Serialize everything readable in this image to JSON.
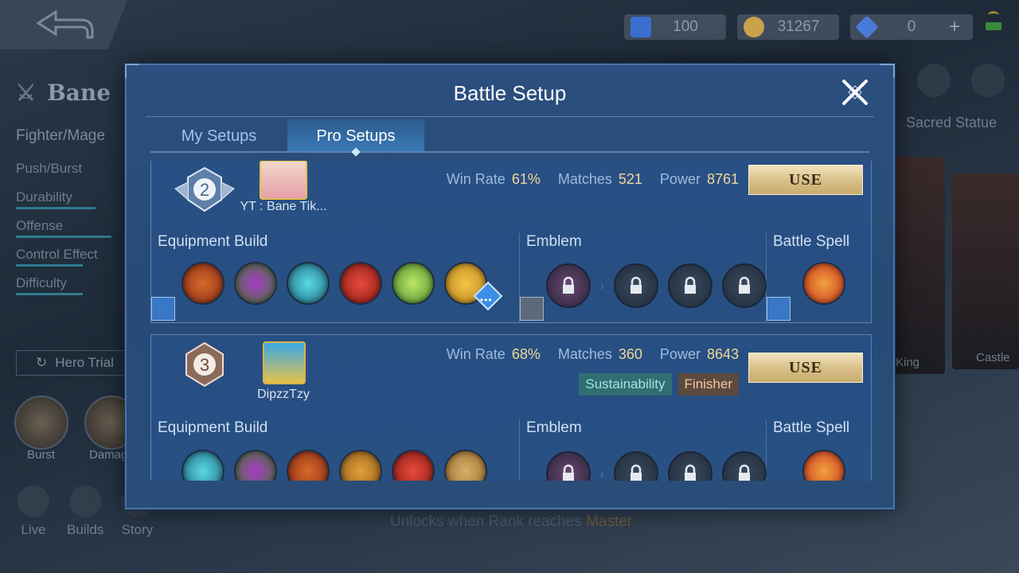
{
  "background": {
    "resources": [
      {
        "name": "ticket",
        "value": "100",
        "color": "#3a6fd0"
      },
      {
        "name": "battle-points",
        "value": "31267",
        "color": "#c9a24a"
      },
      {
        "name": "diamonds",
        "value": "0",
        "color": "#4a7ad8"
      }
    ],
    "plus_label": "+",
    "hero": {
      "name": "Bane",
      "role": "Fighter/Mage",
      "stats": [
        "Push/Burst",
        "Durability",
        "Offense",
        "Control Effect",
        "Difficulty"
      ],
      "hero_trial_label": "Hero Trial",
      "skills": [
        "Burst",
        "Damage"
      ]
    },
    "bottom_nav": [
      "Live",
      "Builds",
      "Story"
    ],
    "sacred_statue_label": "Sacred Statue",
    "cards": [
      "King",
      "Castle"
    ],
    "unlock_text": "Unlocks when Rank reaches ",
    "unlock_rank": "Master"
  },
  "dialog": {
    "title": "Battle Setup",
    "tabs": [
      {
        "label": "My Setups",
        "active": false
      },
      {
        "label": "Pro Setups",
        "active": true
      }
    ],
    "labels": {
      "win_rate": "Win Rate",
      "matches": "Matches",
      "power": "Power",
      "use": "USE",
      "equipment": "Equipment Build",
      "emblem": "Emblem",
      "spell": "Battle Spell"
    },
    "setups": [
      {
        "rank": "2",
        "player": "YT : Bane Tik...",
        "win_rate": "61%",
        "matches": "521",
        "power": "8761",
        "tags": [],
        "items": [
          "#8a2a16",
          "#3f7a2a",
          "#1d6a7e",
          "#8a1a16",
          "#4d8a28",
          "#b8801a"
        ],
        "emblems": [
          "wheel-lock",
          "flame-lock",
          "horns-lock",
          "ring-lock"
        ],
        "spell_color": "#c8341a"
      },
      {
        "rank": "3",
        "player": "DipzzTzy",
        "win_rate": "68%",
        "matches": "360",
        "power": "8643",
        "tags": [
          "Sustainability",
          "Finisher"
        ],
        "items": [
          "#1d6a7e",
          "#3f7a2a",
          "#8a2a16",
          "#8a5a1a",
          "#8a1a16",
          "#9a6a2a"
        ],
        "emblems": [
          "wheel-lock",
          "flame-lock",
          "swirl-lock",
          "ring-lock"
        ],
        "spell_color": "#c8341a"
      }
    ]
  }
}
